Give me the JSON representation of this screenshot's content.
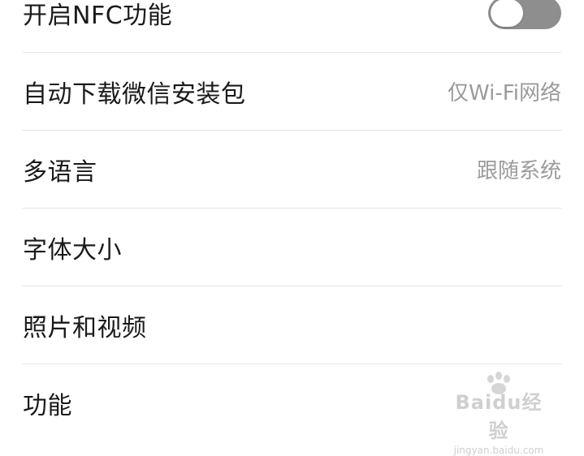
{
  "settings": {
    "nfc": {
      "label": "开启NFC功能",
      "enabled": false
    },
    "auto_download": {
      "label": "自动下载微信安装包",
      "value": "仅Wi-Fi网络"
    },
    "language": {
      "label": "多语言",
      "value": "跟随系统"
    },
    "font_size": {
      "label": "字体大小"
    },
    "photos_videos": {
      "label": "照片和视频"
    },
    "features": {
      "label": "功能"
    }
  },
  "watermark": {
    "brand": "Baidu经验",
    "url": "jingyan.baidu.com"
  },
  "colors": {
    "toggle_off": "#8e8e8e",
    "divider": "#e3e3e3",
    "label_text": "#1a1a1a",
    "value_text": "#9b9b9b"
  }
}
